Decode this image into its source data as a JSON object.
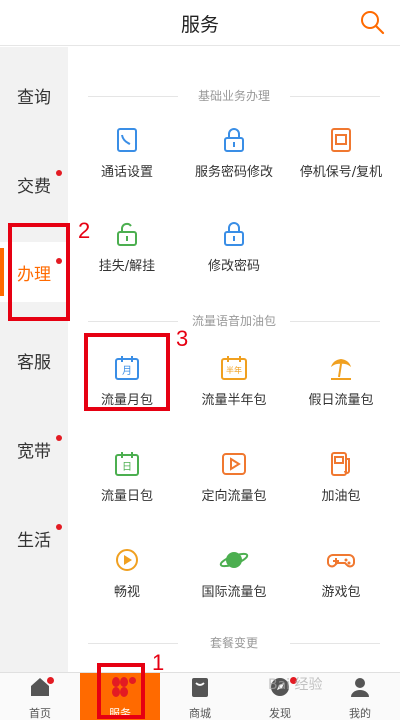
{
  "header": {
    "title": "服务"
  },
  "sidebar": {
    "items": [
      {
        "label": "查询",
        "dot": false
      },
      {
        "label": "交费",
        "dot": true
      },
      {
        "label": "办理",
        "dot": true,
        "active": true
      },
      {
        "label": "客服",
        "dot": false
      },
      {
        "label": "宽带",
        "dot": true
      },
      {
        "label": "生活",
        "dot": true
      }
    ]
  },
  "sections": {
    "basic": {
      "title": "基础业务办理",
      "items": [
        {
          "label": "通话设置",
          "icon": "phone-settings-icon"
        },
        {
          "label": "服务密码修改",
          "icon": "lock-icon"
        },
        {
          "label": "停机保号/复机",
          "icon": "sim-suspend-icon"
        },
        {
          "label": "挂失/解挂",
          "icon": "unlock-icon"
        },
        {
          "label": "修改密码",
          "icon": "lock-edit-icon"
        }
      ]
    },
    "data": {
      "title": "流量语音加油包",
      "items": [
        {
          "label": "流量月包",
          "icon": "calendar-month-icon",
          "icon_text": "月"
        },
        {
          "label": "流量半年包",
          "icon": "calendar-halfyear-icon",
          "icon_text": "半年"
        },
        {
          "label": "假日流量包",
          "icon": "beach-icon"
        },
        {
          "label": "流量日包",
          "icon": "calendar-day-icon",
          "icon_text": "日"
        },
        {
          "label": "定向流量包",
          "icon": "play-icon"
        },
        {
          "label": "加油包",
          "icon": "fuel-icon"
        },
        {
          "label": "畅视",
          "icon": "video-icon"
        },
        {
          "label": "国际流量包",
          "icon": "planet-icon"
        },
        {
          "label": "游戏包",
          "icon": "gamepad-icon"
        }
      ]
    },
    "plan": {
      "title": "套餐变更"
    }
  },
  "tabbar": {
    "items": [
      {
        "label": "首页",
        "icon": "home-icon",
        "dot": true
      },
      {
        "label": "服务",
        "icon": "service-icon",
        "dot": true,
        "active": true
      },
      {
        "label": "商城",
        "icon": "shop-icon",
        "dot": false
      },
      {
        "label": "发现",
        "icon": "discover-icon",
        "dot": true
      },
      {
        "label": "我的",
        "icon": "profile-icon",
        "dot": false
      }
    ]
  },
  "annotations": {
    "n1": "1",
    "n2": "2",
    "n3": "3"
  },
  "watermark": "Bai 经验",
  "colors": {
    "accent": "#ff6a00",
    "annotation": "#e60012",
    "blue_icon": "#3a8ee6",
    "green_icon": "#4caf50"
  }
}
